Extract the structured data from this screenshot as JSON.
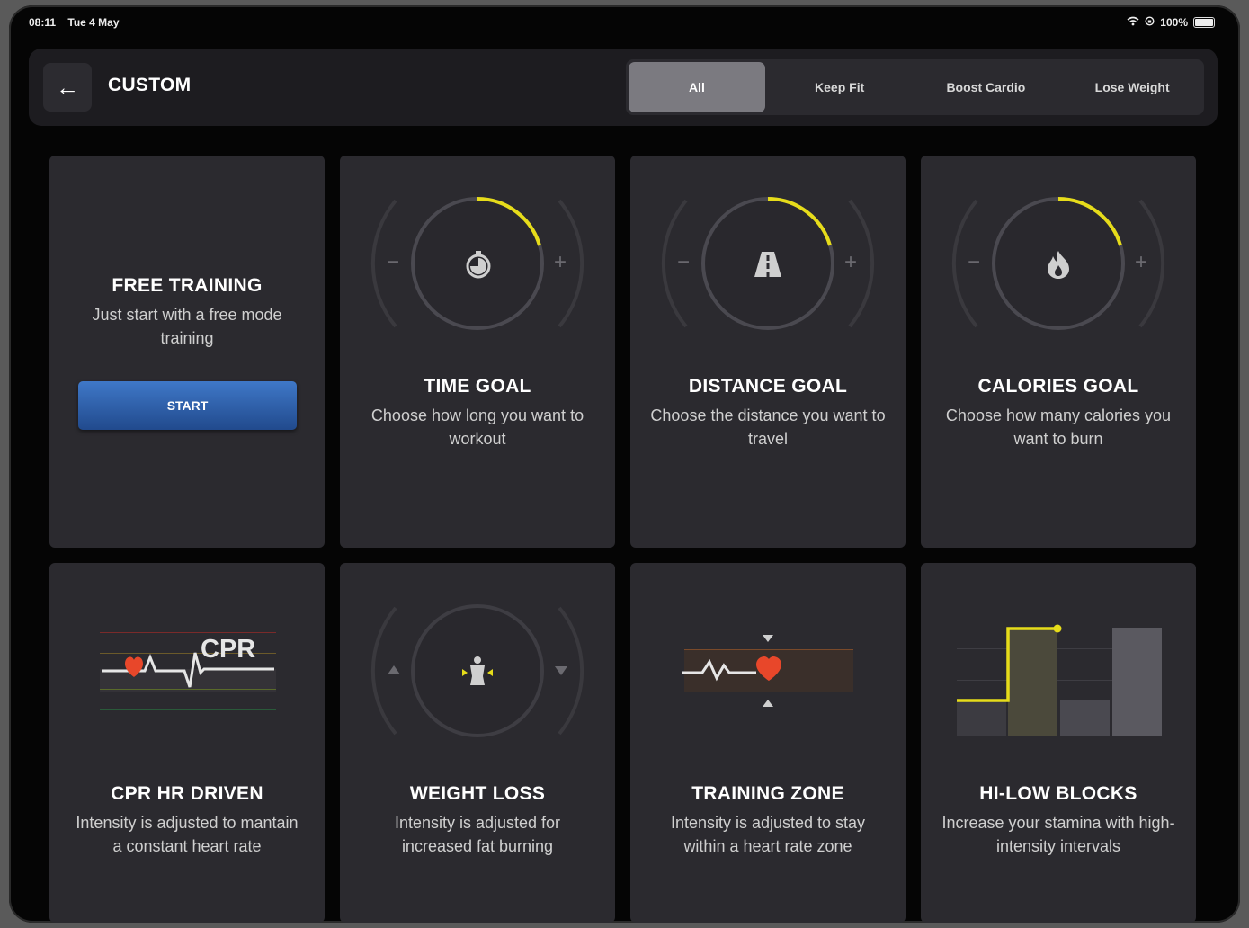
{
  "status": {
    "time": "08:11",
    "date": "Tue 4 May",
    "battery": "100%"
  },
  "header": {
    "back_icon": "←",
    "title": "CUSTOM",
    "tabs": [
      {
        "label": "All",
        "active": true
      },
      {
        "label": "Keep Fit",
        "active": false
      },
      {
        "label": "Boost Cardio",
        "active": false
      },
      {
        "label": "Lose Weight",
        "active": false
      }
    ]
  },
  "cards": {
    "free_training": {
      "title": "FREE TRAINING",
      "desc": "Just start with a free mode training",
      "button": "START"
    },
    "time_goal": {
      "title": "TIME GOAL",
      "desc": "Choose how long you want to workout",
      "icon": "stopwatch-icon",
      "minus": "−",
      "plus": "+"
    },
    "distance_goal": {
      "title": "DISTANCE GOAL",
      "desc": "Choose the distance you want to travel",
      "icon": "road-icon",
      "minus": "−",
      "plus": "+"
    },
    "calories_goal": {
      "title": "CALORIES GOAL",
      "desc": "Choose how many calories you want to burn",
      "icon": "flame-icon",
      "minus": "−",
      "plus": "+"
    },
    "cpr_hr": {
      "title": "CPR HR DRIVEN",
      "desc": "Intensity is adjusted to mantain a constant heart rate",
      "illus_text": "CPR"
    },
    "weight_loss": {
      "title": "WEIGHT LOSS",
      "desc": "Intensity is adjusted for increased fat burning",
      "icon": "body-icon"
    },
    "training_zone": {
      "title": "TRAINING ZONE",
      "desc": "Intensity is adjusted to stay within a heart rate zone",
      "icon": "heart-icon"
    },
    "hi_low": {
      "title": "HI-LOW BLOCKS",
      "desc": "Increase your stamina with high-intensity intervals"
    }
  },
  "colors": {
    "accent_yellow": "#e6dc1a",
    "heart_red": "#e8472a",
    "start_blue": "#2f5fa8",
    "card_bg": "#2b2a2f"
  }
}
